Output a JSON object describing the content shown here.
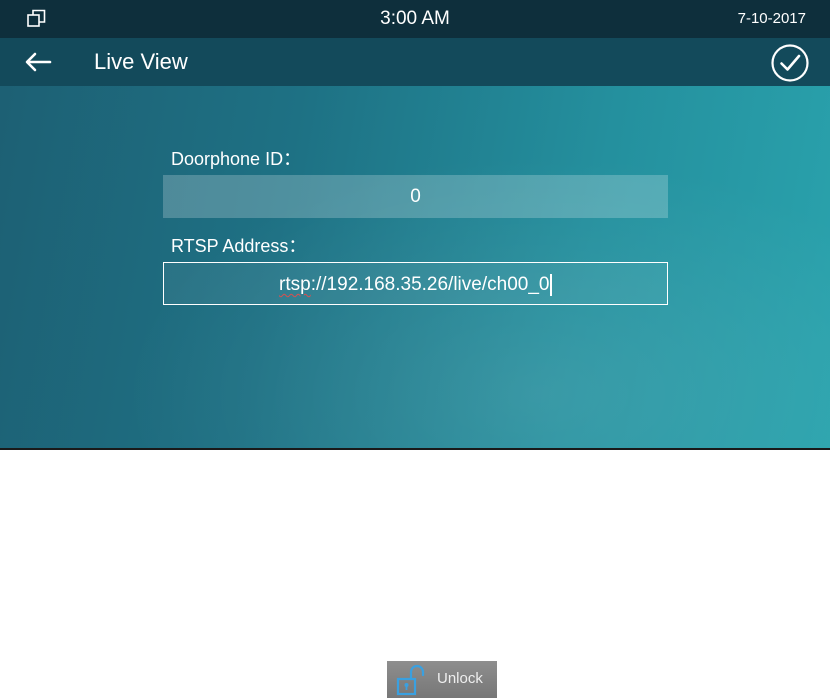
{
  "status_bar": {
    "time": "3:00 AM",
    "date": "7-10-2017",
    "left_icon": "window-restore-icon"
  },
  "app_bar": {
    "back_icon": "arrow-left-icon",
    "title": "Live View",
    "confirm_icon": "check-circle-icon"
  },
  "form": {
    "doorphone_id": {
      "label": "Doorphone ID：",
      "value": "0"
    },
    "rtsp_address": {
      "label": "RTSP Address：",
      "value_prefix": "rtsp",
      "value_rest": "://192.168.35.26/live/ch00_0"
    }
  },
  "unlock": {
    "label": "Unlock",
    "icon": "unlock-icon"
  },
  "colors": {
    "status_bar": "#0e2f3c",
    "app_bar": "#134a5b",
    "background_start": "#1d5f73",
    "background_end": "#2aa3ad",
    "unlock_icon_blue": "#3aa0e0"
  }
}
